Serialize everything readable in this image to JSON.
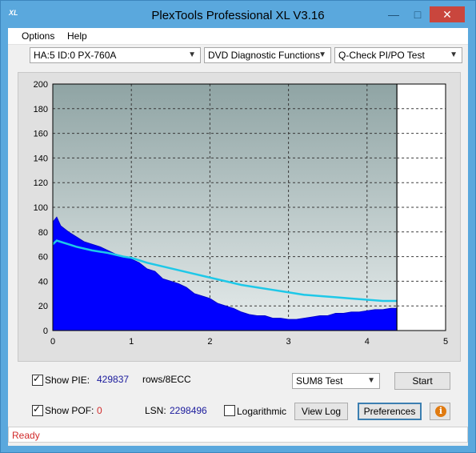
{
  "window": {
    "title": "PlexTools Professional XL V3.16",
    "icon_text": "XL",
    "minimize_icon": "minimize-icon",
    "maximize_icon": "maximize-icon",
    "close_icon": "close-icon"
  },
  "menu": {
    "options": "Options",
    "help": "Help"
  },
  "toolbar": {
    "drive": "HA:5 ID:0  PX-760A",
    "function": "DVD Diagnostic Functions",
    "test": "Q-Check PI/PO Test"
  },
  "chart_data": {
    "type": "area",
    "xlabel": "",
    "ylabel": "",
    "xlim": [
      0,
      5
    ],
    "ylim": [
      0,
      200
    ],
    "x_ticks": [
      "0",
      "1",
      "2",
      "3",
      "4",
      "5"
    ],
    "y_ticks": [
      "0",
      "20",
      "40",
      "60",
      "80",
      "100",
      "120",
      "140",
      "160",
      "180",
      "200"
    ],
    "grid": true,
    "end_marker_x": 4.38,
    "colors": {
      "pie": "#0000ff",
      "sum8_line": "#1ec8e8",
      "background": "#95aaaa"
    },
    "series": [
      {
        "type": "area",
        "x": [
          0.0,
          0.05,
          0.1,
          0.2,
          0.3,
          0.4,
          0.5,
          0.6,
          0.7,
          0.8,
          0.9,
          1.0,
          1.1,
          1.2,
          1.3,
          1.4,
          1.5,
          1.6,
          1.7,
          1.8,
          1.9,
          2.0,
          2.1,
          2.2,
          2.3,
          2.4,
          2.5,
          2.6,
          2.7,
          2.8,
          2.9,
          3.0,
          3.1,
          3.2,
          3.3,
          3.4,
          3.5,
          3.6,
          3.7,
          3.8,
          3.9,
          4.0,
          4.1,
          4.2,
          4.3,
          4.38
        ],
        "values": [
          88,
          92,
          85,
          80,
          76,
          72,
          70,
          68,
          65,
          62,
          60,
          58,
          55,
          50,
          48,
          42,
          40,
          38,
          35,
          30,
          28,
          26,
          22,
          20,
          18,
          15,
          13,
          12,
          12,
          10,
          10,
          9,
          9,
          10,
          11,
          12,
          12,
          14,
          14,
          15,
          15,
          16,
          17,
          17,
          18,
          18
        ]
      },
      {
        "type": "line",
        "x": [
          0.0,
          0.05,
          0.1,
          0.2,
          0.3,
          0.5,
          0.7,
          0.9,
          1.0,
          1.2,
          1.4,
          1.6,
          1.8,
          2.0,
          2.2,
          2.4,
          2.6,
          2.8,
          3.0,
          3.2,
          3.4,
          3.6,
          3.8,
          4.0,
          4.2,
          4.38
        ],
        "values": [
          70,
          73,
          72,
          70,
          68,
          65,
          63,
          60,
          59,
          55,
          52,
          49,
          46,
          43,
          40,
          37,
          35,
          33,
          31,
          29,
          28,
          27,
          26,
          25,
          24,
          24
        ]
      }
    ]
  },
  "controls": {
    "show_pie_label": "Show PIE:",
    "pie_value": "429837",
    "pie_unit": "rows/8ECC",
    "show_poe_label": "Show POF:",
    "poe_value": "0",
    "lsn_label": "LSN:",
    "lsn_value": "2298496",
    "logarithmic_label": "Logarithmic",
    "sum_select": "SUM8 Test",
    "start": "Start",
    "view_log": "View Log",
    "preferences": "Preferences",
    "show_pie_checked": true,
    "show_poe_checked": true,
    "logarithmic_checked": false
  },
  "status": {
    "text": "Ready"
  }
}
